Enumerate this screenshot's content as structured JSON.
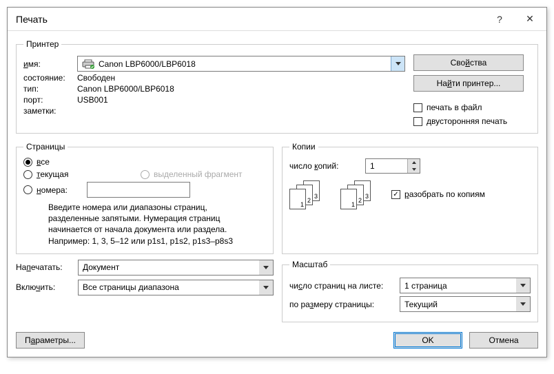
{
  "title": "Печать",
  "help": "?",
  "close": "✕",
  "printer": {
    "legend": "Принтер",
    "name_label": "имя:",
    "name_value": "Canon LBP6000/LBP6018",
    "status_label": "состояние:",
    "status_value": "Свободен",
    "type_label": "тип:",
    "type_value": "Canon LBP6000/LBP6018",
    "port_label": "порт:",
    "port_value": "USB001",
    "notes_label": "заметки:",
    "notes_value": "",
    "properties_btn": "Свойства",
    "find_btn": "Найти принтер...",
    "to_file_chk": "печать в файл",
    "duplex_chk": "двусторонняя печать"
  },
  "pages": {
    "legend": "Страницы",
    "all": "все",
    "current": "текущая",
    "selection": "выделенный фрагмент",
    "numbers": "номера:",
    "numbers_value": "",
    "hint": "Введите номера или диапазоны страниц, разделенные запятыми. Нумерация страниц начинается от начала документа или раздела. Например: 1, 3, 5–12 или p1s1, p1s2, p1s3–p8s3"
  },
  "copies": {
    "legend": "Копии",
    "count_label": "число копий:",
    "count_value": "1",
    "collate": "разобрать по копиям",
    "seq": [
      "1",
      "2",
      "3"
    ]
  },
  "print_what": {
    "label": "Напечатать:",
    "value": "Документ"
  },
  "include": {
    "label": "Включить:",
    "value": "Все страницы диапазона"
  },
  "scale": {
    "legend": "Масштаб",
    "per_sheet_label": "число страниц на листе:",
    "per_sheet_value": "1 страница",
    "fit_label": "по размеру страницы:",
    "fit_value": "Текущий"
  },
  "footer": {
    "options": "Параметры...",
    "ok": "OK",
    "cancel": "Отмена"
  }
}
